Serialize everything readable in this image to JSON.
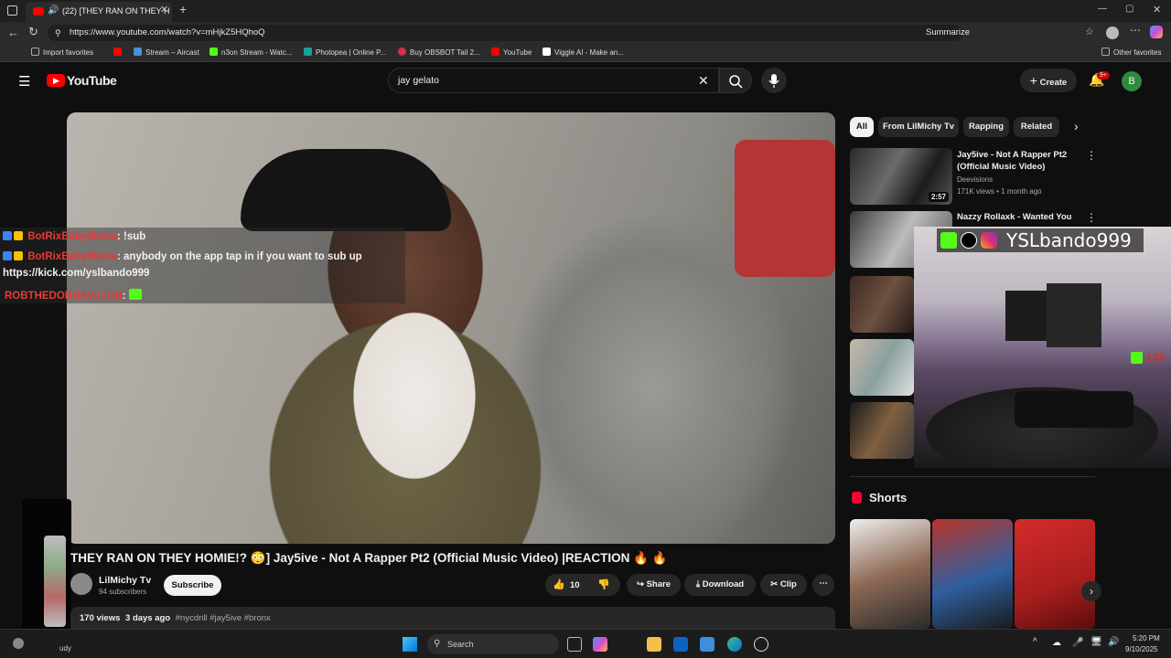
{
  "browser": {
    "tab_title": "(22) [THEY RAN ON THEY H",
    "url": "https://www.youtube.com/watch?v=mHjkZ5HQhoQ",
    "summarize": "Summarize",
    "favorites": [
      {
        "label": "Import favorites",
        "color": "#888888"
      },
      {
        "label": "",
        "color": "#ff0000"
      },
      {
        "label": "Stream – Aircast",
        "color": "#4a90d9"
      },
      {
        "label": "n3on Stream - Watc...",
        "color": "#53fc18"
      },
      {
        "label": "Photopea | Online P...",
        "color": "#18a497"
      },
      {
        "label": "Buy OBSBOT Tail 2...",
        "color": "#d1324a"
      },
      {
        "label": "YouTube",
        "color": "#ff0000"
      },
      {
        "label": "Viggle AI - Make an...",
        "color": "#ffffff"
      }
    ],
    "other_favorites": "Other favorites"
  },
  "youtube": {
    "logo_text": "YouTube",
    "search_value": "jay gelato",
    "create_label": "Create",
    "notif_count": "9+",
    "avatar_letter": "B"
  },
  "chat": [
    {
      "user": "BotRixBabyMama",
      "message": ": !sub"
    },
    {
      "user": "BotRixBabyMama",
      "message": ": anybody on the app tap in if you want to sub up"
    },
    {
      "user": "",
      "message": "https://kick.com/yslbando999"
    },
    {
      "user": "ROBTHEDOBHAVAJOB",
      "message": ":"
    }
  ],
  "video": {
    "title": "THEY RAN ON THEY HOMIE!? 😳] Jay5ive - Not A Rapper Pt2 (Official Music Video) |REACTION 🔥 🔥",
    "channel": "LilMichy Tv",
    "subscribers": "94 subscribers",
    "subscribe_label": "Subscribe",
    "likes": "10",
    "share_label": "Share",
    "download_label": "Download",
    "clip_label": "Clip",
    "views": "170 views",
    "age": "3 days ago",
    "hashtags": "#nycdrill #jay5ive #bronx"
  },
  "chips": [
    "All",
    "From LilMichy Tv",
    "Rapping",
    "Related"
  ],
  "related": [
    {
      "title": "Jay5ive - Not A Rapper Pt2 (Official Music Video)",
      "channel": "Deevisions",
      "meta": "171K views • 1 month ago",
      "duration": "2:57"
    },
    {
      "title": "Nazzy Rollaxk - Wanted You",
      "channel": "",
      "meta": "",
      "duration": ""
    }
  ],
  "shorts_label": "Shorts",
  "cam_overlay": {
    "handle": "YSLbando999",
    "viewer_count": "138"
  },
  "taskbar": {
    "search_placeholder": "Search",
    "time": "5:20 PM",
    "date": "9/10/2025",
    "weather": "udy"
  }
}
